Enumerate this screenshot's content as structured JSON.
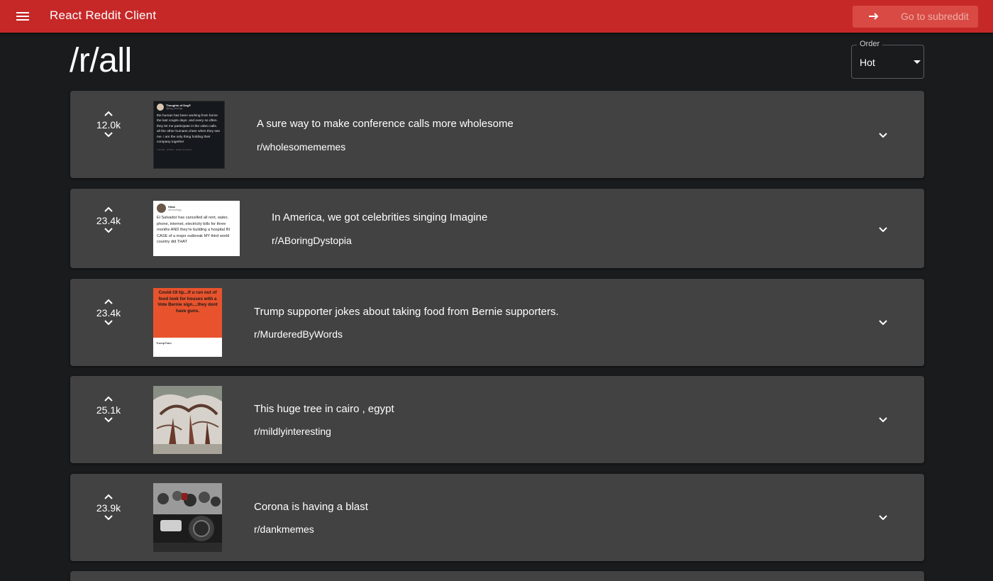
{
  "app": {
    "title": "React Reddit Client",
    "accent_color": "#c62828",
    "menu_icon": "menu-icon",
    "goto_button": {
      "label": "Go to subreddit",
      "icon": "arrow-right-icon"
    }
  },
  "page": {
    "title": "/r/all",
    "order": {
      "legend": "Order",
      "value": "Hot"
    }
  },
  "posts": [
    {
      "score": "12.0k",
      "title": "A sure way to make conference calls more wholesome",
      "subreddit": "r/wholesomememes"
    },
    {
      "score": "23.4k",
      "title": "In America, we got celebrities singing Imagine",
      "subreddit": "r/ABoringDystopia"
    },
    {
      "score": "23.4k",
      "title": "Trump supporter jokes about taking food from Bernie supporters.",
      "subreddit": "r/MurderedByWords"
    },
    {
      "score": "25.1k",
      "title": "This huge tree in cairo , egypt",
      "subreddit": "r/mildlyinteresting"
    },
    {
      "score": "23.9k",
      "title": "Corona is having a blast",
      "subreddit": "r/dankmemes"
    }
  ],
  "thumbnails": {
    "post1": {
      "author": "Thoughts of Dog®",
      "handle": "@dog_feelings",
      "text": "the human has been working from home the last couple days. and every so often. they let me participate in the video calls. all the other humans cheer when they see me. i am the only thing holding their company together",
      "footer": "1:35 PM · 3/15/20 · Twitter for iPhone"
    },
    "post2": {
      "author": "Hilda",
      "handle": "@hildaflagg",
      "text": "El Salvador has cancelled all rent, water, phone, internet, electricity bills for three months AND they're building a hospital IN CASE of a major outbreak MY third world country did THAT"
    },
    "post3": {
      "text": "Covid-19 tip...If u run out of food look for houses with a Vote Bernie sign....they dont have guns.",
      "footer": "TrumpTrain"
    }
  }
}
